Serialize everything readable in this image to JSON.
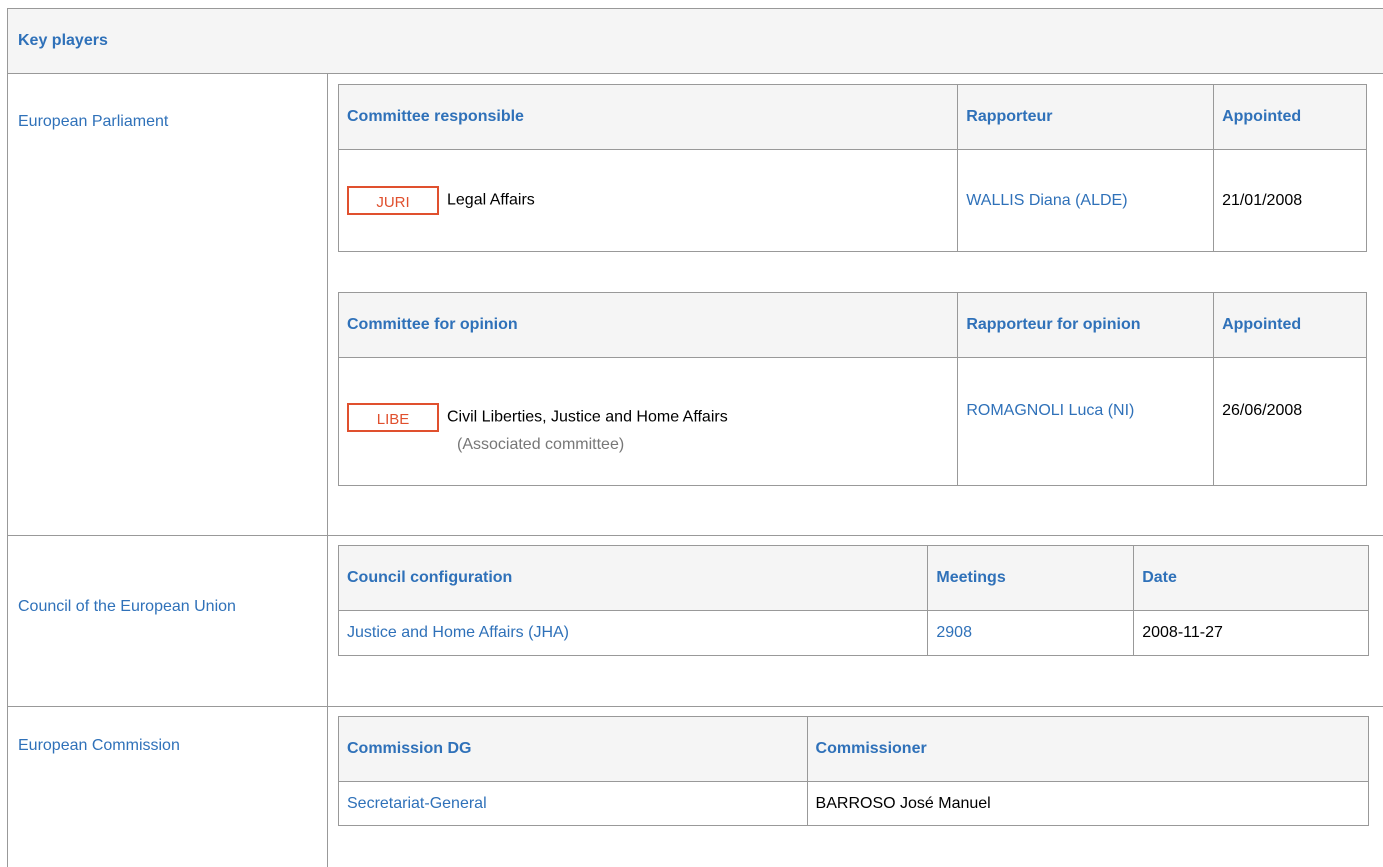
{
  "key_players": {
    "title": "Key players"
  },
  "parliament": {
    "label": "European Parliament",
    "responsible": {
      "headers": [
        "Committee responsible",
        "Rapporteur",
        "Appointed"
      ],
      "badge": "JURI",
      "committee": "Legal Affairs",
      "rapporteur": "WALLIS Diana (ALDE)",
      "appointed": "21/01/2008"
    },
    "opinion": {
      "headers": [
        "Committee for opinion",
        "Rapporteur for opinion",
        "Appointed"
      ],
      "badge": "LIBE",
      "committee": "Civil Liberties, Justice and Home Affairs",
      "note": "(Associated committee)",
      "rapporteur": "ROMAGNOLI Luca (NI)",
      "appointed": "26/06/2008"
    }
  },
  "council": {
    "label": "Council of the European Union",
    "headers": [
      "Council configuration",
      "Meetings",
      "Date"
    ],
    "configuration": "Justice and Home Affairs (JHA)",
    "meeting": "2908",
    "date": "2008-11-27"
  },
  "commission": {
    "label": "European Commission",
    "headers": [
      "Commission DG",
      "Commissioner"
    ],
    "dg": "Secretariat-General",
    "commissioner": "BARROSO José Manuel"
  }
}
